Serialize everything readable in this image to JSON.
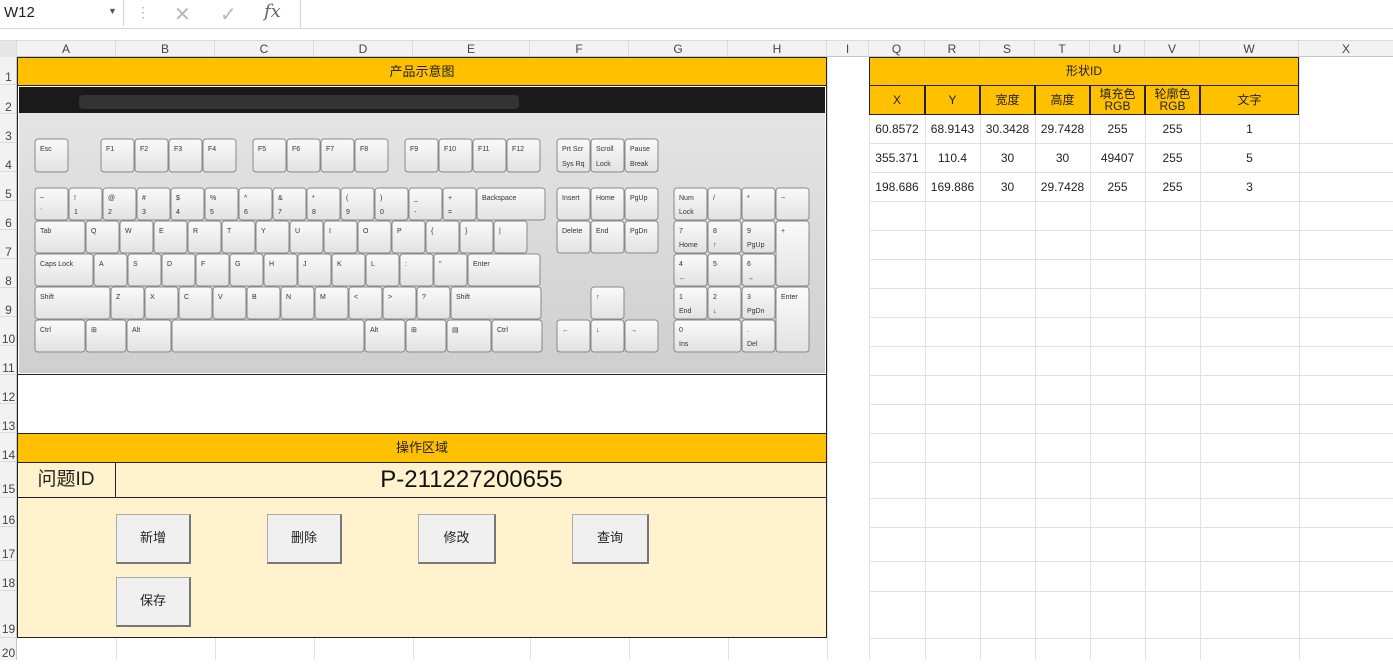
{
  "formula_bar": {
    "name_box": "W12",
    "cancel_icon": "x-icon",
    "enter_icon": "check-icon",
    "fx_label": "fx"
  },
  "columns": [
    "A",
    "B",
    "C",
    "D",
    "E",
    "F",
    "G",
    "H",
    "I",
    "Q",
    "R",
    "S",
    "T",
    "U",
    "V",
    "W",
    "X"
  ],
  "rows": [
    "1",
    "2",
    "3",
    "4",
    "5",
    "6",
    "7",
    "8",
    "9",
    "10",
    "11",
    "12",
    "13",
    "14",
    "15",
    "16",
    "17",
    "18",
    "19",
    "20"
  ],
  "product": {
    "header": "产品示意图",
    "image_icon": "keyboard-image",
    "keys": {
      "row_f": [
        "Esc",
        "F1",
        "F2",
        "F3",
        "F4",
        "F5",
        "F6",
        "F7",
        "F8",
        "F9",
        "F10",
        "F11",
        "F12"
      ],
      "row_num": [
        "~",
        "!",
        "@",
        "#",
        "$",
        "%",
        "^",
        "&",
        "*",
        "(",
        ")",
        "_",
        "+",
        "Backspace"
      ],
      "row_num2": [
        "`",
        "1",
        "2",
        "3",
        "4",
        "5",
        "6",
        "7",
        "8",
        "9",
        "0",
        "-",
        "="
      ],
      "row_q": [
        "Tab",
        "Q",
        "W",
        "E",
        "R",
        "T",
        "Y",
        "U",
        "I",
        "O",
        "P",
        "{",
        "}",
        "|"
      ],
      "row_a": [
        "Caps Lock",
        "A",
        "S",
        "D",
        "F",
        "G",
        "H",
        "J",
        "K",
        "L",
        ":",
        "\"",
        "Enter"
      ],
      "row_z": [
        "Shift",
        "Z",
        "X",
        "C",
        "V",
        "B",
        "N",
        "M",
        "<",
        ">",
        "?",
        "Shift"
      ],
      "row_bottom": [
        "Ctrl",
        "Alt",
        "Alt",
        "Ctrl"
      ],
      "nav1": [
        "Prt Scr",
        "Scroll",
        "Pause"
      ],
      "nav1b": [
        "Sys Rq",
        "Lock",
        "Break"
      ],
      "nav2": [
        "Insert",
        "Home",
        "PgUp"
      ],
      "nav3": [
        "Delete",
        "End",
        "PgDn"
      ],
      "numpad_top": [
        "Num",
        "/",
        "*",
        "−"
      ],
      "numpad_lock": "Lock",
      "numpad": [
        "7",
        "8",
        "9",
        "4",
        "5",
        "6",
        "1",
        "2",
        "3",
        "0",
        "."
      ],
      "numpad_sub": [
        "Home",
        "↑",
        "PgUp",
        "←",
        "",
        "→",
        "End",
        "↓",
        "PgDn",
        "Ins",
        "Del"
      ],
      "numpad_plus": "+",
      "numpad_enter": "Enter",
      "arrows": [
        "↑",
        "←",
        "↓",
        "→"
      ]
    }
  },
  "operation": {
    "header": "操作区域",
    "question_label": "问题ID",
    "question_id": "P-211227200655",
    "buttons": {
      "add": "新增",
      "delete": "删除",
      "modify": "修改",
      "query": "查询",
      "save": "保存"
    }
  },
  "shape_table": {
    "title": "形状ID",
    "headers": [
      "X",
      "Y",
      "宽度",
      "高度",
      "填充色RGB",
      "轮廓色RGB",
      "文字"
    ],
    "header_lines": [
      [
        "X"
      ],
      [
        "Y"
      ],
      [
        "宽度"
      ],
      [
        "高度"
      ],
      [
        "填充色",
        "RGB"
      ],
      [
        "轮廓色",
        "RGB"
      ],
      [
        "文字"
      ]
    ],
    "rows": [
      [
        "60.8572",
        "68.9143",
        "30.3428",
        "29.7428",
        "255",
        "255",
        "1"
      ],
      [
        "355.371",
        "110.4",
        "30",
        "30",
        "49407",
        "255",
        "5"
      ],
      [
        "198.686",
        "169.886",
        "30",
        "29.7428",
        "255",
        "255",
        "3"
      ]
    ]
  }
}
